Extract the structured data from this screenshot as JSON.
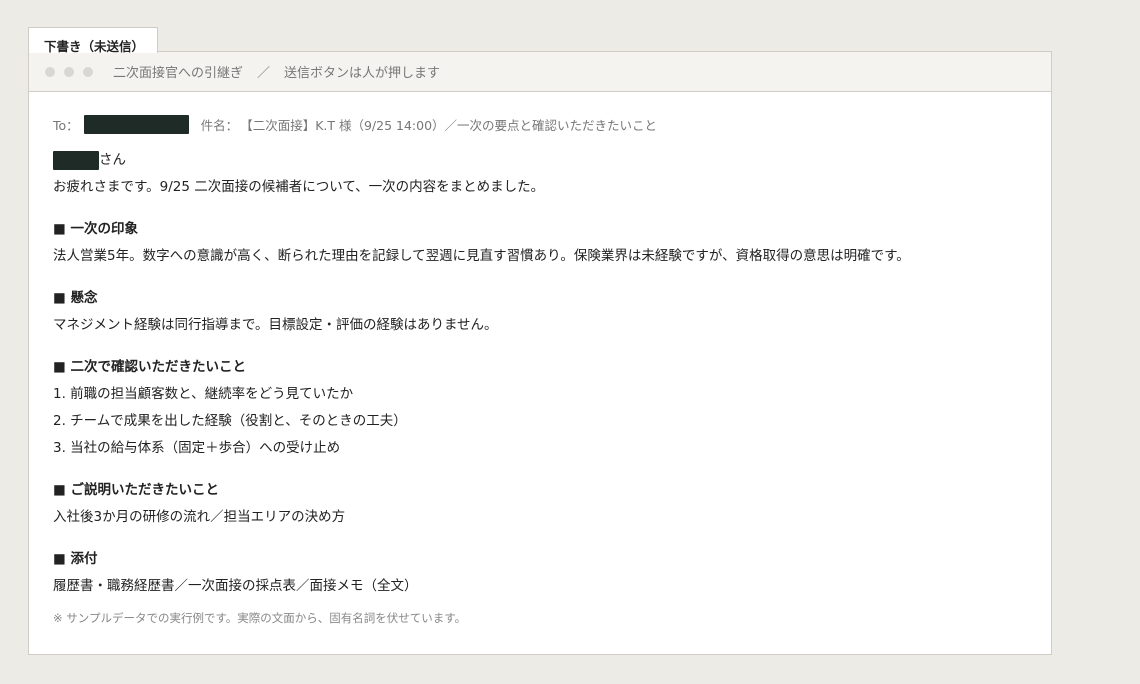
{
  "tab": {
    "label": "下書き（未送信）"
  },
  "titlebar": {
    "left": "二次面接官への引継ぎ",
    "separator": "／",
    "right": "送信ボタンは人が押します"
  },
  "meta": {
    "to_label": "To：",
    "subject_label": "件名：",
    "subject": "【二次面接】K.T 様（9/25 14:00）／一次の要点と確認いただきたいこと"
  },
  "body": {
    "greeting_suffix": "さん",
    "intro": "お疲れさまです。9/25 二次面接の候補者について、一次の内容をまとめました。",
    "sections": [
      {
        "title": "■ 一次の印象",
        "lines": [
          "法人営業5年。数字への意識が高く、断られた理由を記録して翌週に見直す習慣あり。保険業界は未経験ですが、資格取得の意思は明確です。"
        ]
      },
      {
        "title": "■ 懸念",
        "lines": [
          "マネジメント経験は同行指導まで。目標設定・評価の経験はありません。"
        ]
      },
      {
        "title": "■ 二次で確認いただきたいこと",
        "lines": [
          "1. 前職の担当顧客数と、継続率をどう見ていたか",
          "2. チームで成果を出した経験（役割と、そのときの工夫）",
          "3. 当社の給与体系（固定＋歩合）への受け止め"
        ]
      },
      {
        "title": "■ ご説明いただきたいこと",
        "lines": [
          "入社後3か月の研修の流れ／担当エリアの決め方"
        ]
      },
      {
        "title": "■ 添付",
        "lines": [
          "履歴書・職務経歴書／一次面接の採点表／面接メモ（全文）"
        ]
      }
    ]
  },
  "note": "※ サンプルデータでの実行例です。実際の文面から、固有名詞を伏せています。"
}
